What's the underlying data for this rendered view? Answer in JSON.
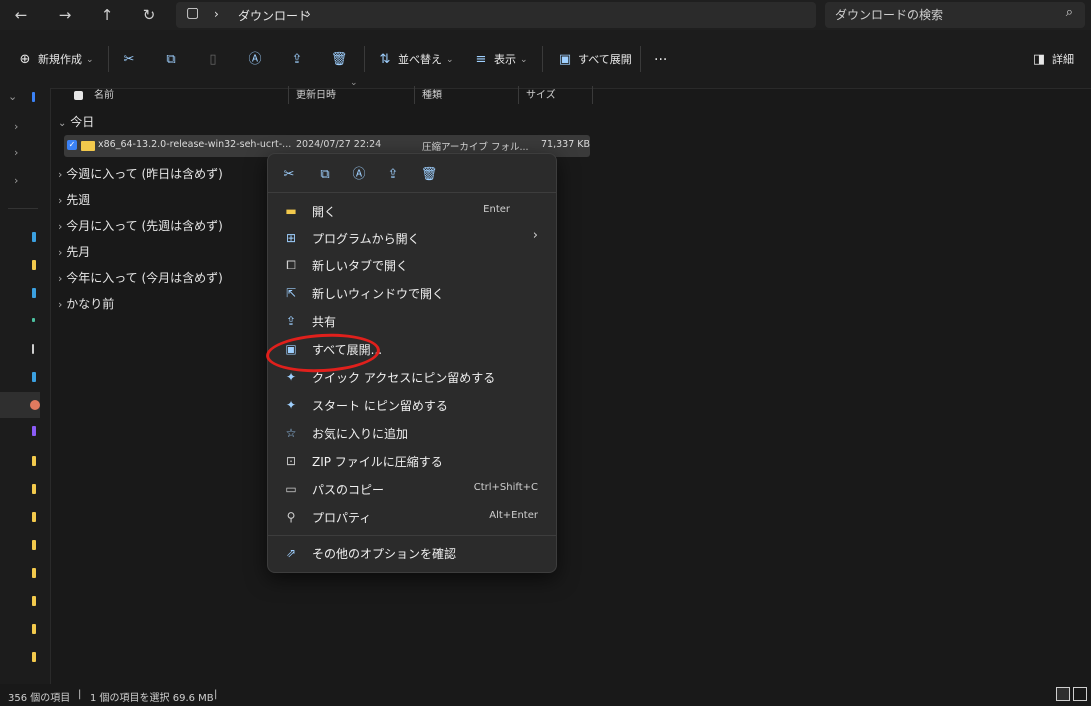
{
  "address": {
    "back_icon": "←",
    "forward_icon": "→",
    "up_icon": "↑",
    "refresh_icon": "↻",
    "pc_icon": "▢",
    "sep": "›",
    "location": "ダウンロード",
    "search_placeholder": "ダウンロードの検索",
    "search_icon": "⌕"
  },
  "toolbar": {
    "new_label": "新規作成",
    "sort_label": "並べ替え",
    "view_label": "表示",
    "extract_label": "すべて展開",
    "more_label": "···",
    "details_label": "詳細"
  },
  "columns": {
    "name": "名前",
    "modified": "更新日時",
    "type": "種類",
    "size": "サイズ"
  },
  "groups": {
    "today": "今日",
    "this_week": "今週に入って (昨日は含めず)",
    "last_week": "先週",
    "this_month": "今月に入って (先週は含めず)",
    "last_month": "先月",
    "this_year": "今年に入って (今月は含めず)",
    "long_ago": "かなり前"
  },
  "file": {
    "name": "x86_64-13.2.0-release-win32-seh-ucrt-...",
    "date": "2024/07/27 22:24",
    "type": "圧縮アーカイブ フォル...",
    "size": "71,337 KB"
  },
  "menu": {
    "open": {
      "label": "開く",
      "shortcut": "Enter"
    },
    "open_with": {
      "label": "プログラムから開く",
      "arrow": "›"
    },
    "open_new_tab": {
      "label": "新しいタブで開く"
    },
    "open_new_window": {
      "label": "新しいウィンドウで開く"
    },
    "share": {
      "label": "共有"
    },
    "extract_all": {
      "label": "すべて展開..."
    },
    "pin_quick": {
      "label": "クイック アクセスにピン留めする"
    },
    "pin_start": {
      "label": "スタート にピン留めする"
    },
    "favorite": {
      "label": "お気に入りに追加"
    },
    "zip": {
      "label": "ZIP ファイルに圧縮する"
    },
    "copy_path": {
      "label": "パスのコピー",
      "shortcut": "Ctrl+Shift+C"
    },
    "properties": {
      "label": "プロパティ",
      "shortcut": "Alt+Enter"
    },
    "more_options": {
      "label": "その他のオプションを確認"
    }
  },
  "status": {
    "items": "356 個の項目",
    "sep1": "|",
    "selected": "1 個の項目を選択  69.6 MB",
    "sep2": "|"
  },
  "colors": {
    "accent": "#9fd0ff",
    "highlight_circle": "#e0201c",
    "folder": "#f2c94c"
  }
}
